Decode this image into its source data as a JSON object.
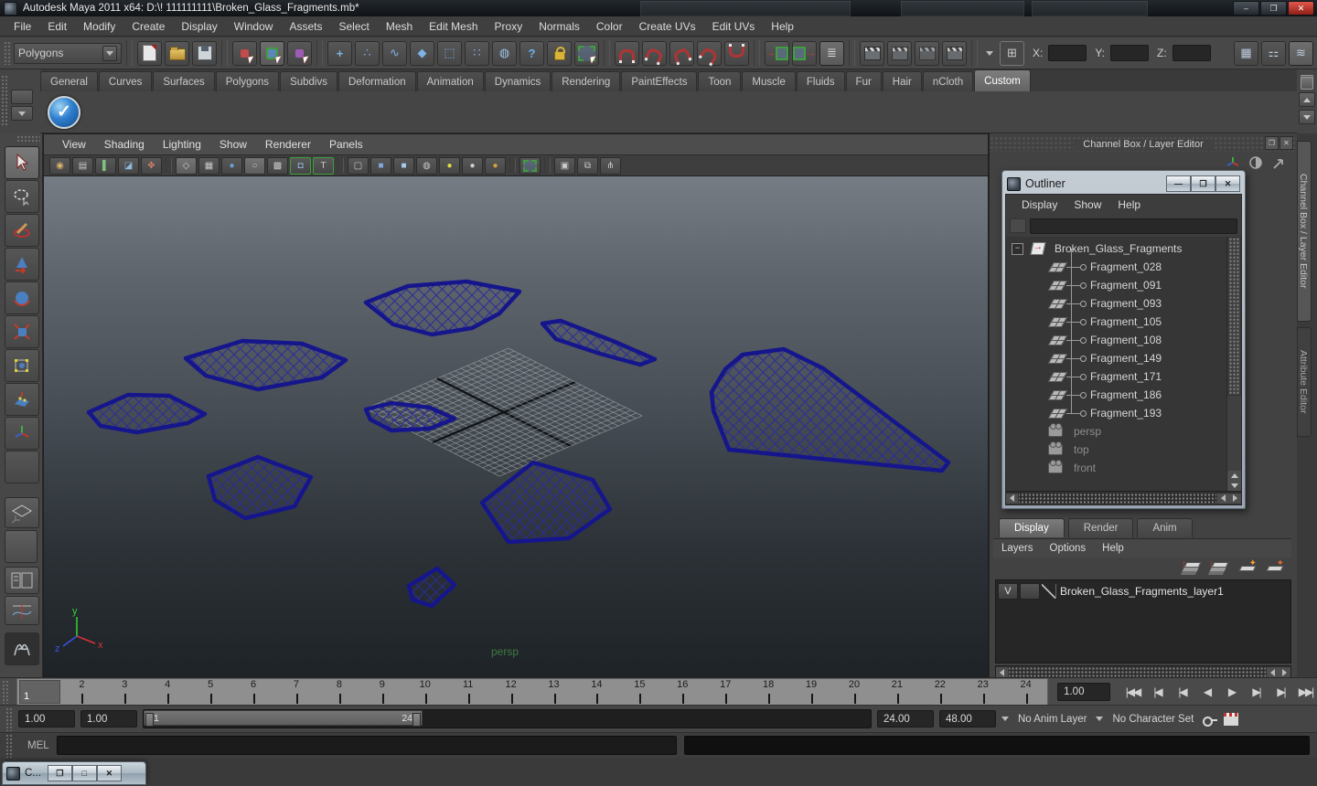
{
  "window": {
    "title": "Autodesk Maya 2011 x64: D:\\! 111111111\\Broken_Glass_Fragments.mb*",
    "minimize": "–",
    "maximize": "❐",
    "close": "✕"
  },
  "menu_bar": [
    "File",
    "Edit",
    "Modify",
    "Create",
    "Display",
    "Window",
    "Assets",
    "Select",
    "Mesh",
    "Edit Mesh",
    "Proxy",
    "Normals",
    "Color",
    "Create UVs",
    "Edit UVs",
    "Help"
  ],
  "status_line": {
    "menu_set": "Polygons",
    "coord_labels": {
      "x": "X:",
      "y": "Y:",
      "z": "Z:"
    },
    "coord_values": {
      "x": "",
      "y": "",
      "z": ""
    },
    "help_glyph": "?"
  },
  "shelf": {
    "tabs": [
      "General",
      "Curves",
      "Surfaces",
      "Polygons",
      "Subdivs",
      "Deformation",
      "Animation",
      "Dynamics",
      "Rendering",
      "PaintEffects",
      "Toon",
      "Muscle",
      "Fluids",
      "Fur",
      "Hair",
      "nCloth",
      "Custom"
    ],
    "active_tab": "Custom",
    "check_glyph": "✓"
  },
  "panel": {
    "menus": [
      "View",
      "Shading",
      "Lighting",
      "Show",
      "Renderer",
      "Panels"
    ],
    "camera_label": "persp",
    "axis_labels": {
      "x": "x",
      "y": "y",
      "z": "z"
    }
  },
  "outliner": {
    "title": "Outliner",
    "buttons": {
      "minimize": "—",
      "maximize": "❐",
      "close": "✕"
    },
    "menus": [
      "Display",
      "Show",
      "Help"
    ],
    "search_value": "",
    "root_expander": "−",
    "root_item": "Broken_Glass_Fragments",
    "fragments": [
      "Fragment_028",
      "Fragment_091",
      "Fragment_093",
      "Fragment_105",
      "Fragment_108",
      "Fragment_149",
      "Fragment_171",
      "Fragment_186",
      "Fragment_193"
    ],
    "cameras": [
      "persp",
      "top",
      "front"
    ]
  },
  "right_panel": {
    "header": "Channel Box / Layer Editor",
    "side_tabs": [
      "Channel Box / Layer Editor",
      "Attribute Editor"
    ]
  },
  "layer_editor": {
    "tabs": [
      "Display",
      "Render",
      "Anim"
    ],
    "active_tab": "Display",
    "menus": [
      "Layers",
      "Options",
      "Help"
    ],
    "layers": [
      {
        "visibility": "V",
        "name": "Broken_Glass_Fragments_layer1"
      }
    ]
  },
  "time_slider": {
    "frames": [
      "1",
      "2",
      "3",
      "4",
      "5",
      "6",
      "7",
      "8",
      "9",
      "10",
      "11",
      "12",
      "13",
      "14",
      "15",
      "16",
      "17",
      "18",
      "19",
      "20",
      "21",
      "22",
      "23",
      "24"
    ],
    "current_frame": "1",
    "current_time_field": "1.00"
  },
  "playback_glyphs": [
    "|◀◀",
    "|◀",
    "|◀",
    "◀",
    "▶",
    "▶|",
    "▶|",
    "▶▶|"
  ],
  "range_slider": {
    "anim_start": "1.00",
    "playback_start": "1.00",
    "range_start_label": "1",
    "range_end_label": "24",
    "playback_end": "24.00",
    "anim_end": "48.00",
    "anim_layer": "No Anim Layer",
    "character_set": "No Character Set"
  },
  "command_line": {
    "label": "MEL",
    "input_value": ""
  },
  "taskbar_window": {
    "title": "C...",
    "restore": "❐",
    "maximize": "□",
    "close": "✕"
  }
}
